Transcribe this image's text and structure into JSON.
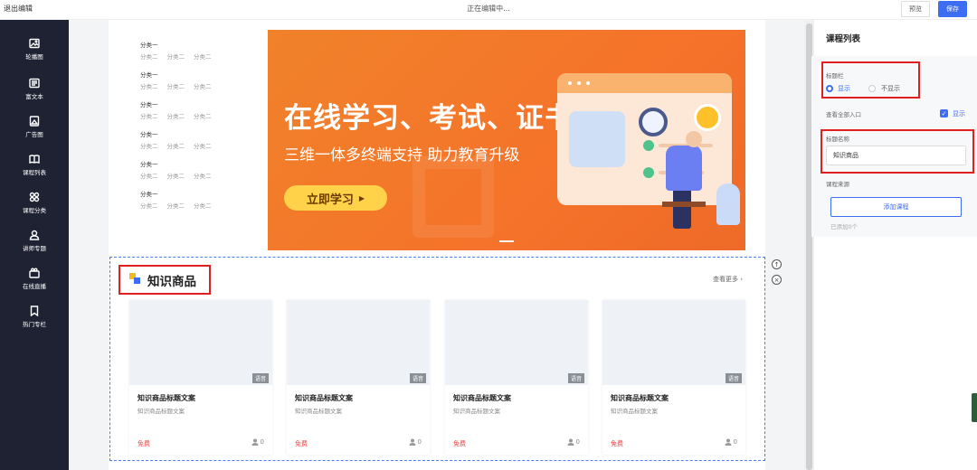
{
  "topbar": {
    "exit_label": "退出编辑",
    "status": "正在编辑中...",
    "preview_label": "预览",
    "save_label": "保存"
  },
  "sidebar": {
    "items": [
      {
        "label": "轮播图",
        "icon": "image-icon"
      },
      {
        "label": "富文本",
        "icon": "rich-text-icon"
      },
      {
        "label": "广告图",
        "icon": "ad-image-icon"
      },
      {
        "label": "课程列表",
        "icon": "book-icon"
      },
      {
        "label": "课程分类",
        "icon": "grid-icon"
      },
      {
        "label": "讲师专题",
        "icon": "user-icon"
      },
      {
        "label": "在线直播",
        "icon": "live-icon"
      },
      {
        "label": "热门专栏",
        "icon": "bookmark-icon"
      }
    ]
  },
  "categories": [
    {
      "title": "分类一",
      "subs": [
        "分类二",
        "分类二",
        "分类二"
      ]
    },
    {
      "title": "分类一",
      "subs": [
        "分类二",
        "分类二",
        "分类二"
      ]
    },
    {
      "title": "分类一",
      "subs": [
        "分类二",
        "分类二",
        "分类二"
      ]
    },
    {
      "title": "分类一",
      "subs": [
        "分类二",
        "分类二",
        "分类二"
      ]
    },
    {
      "title": "分类一",
      "subs": [
        "分类二",
        "分类二",
        "分类二"
      ]
    },
    {
      "title": "分类一",
      "subs": [
        "分类二",
        "分类二",
        "分类二"
      ]
    }
  ],
  "banner": {
    "headline": "在线学习、考试、证书",
    "subline": "三维一体多终端支持 助力教育升级",
    "cta": "立即学习"
  },
  "section": {
    "title": "知识商品",
    "see_more": "查看更多",
    "cards": [
      {
        "tag": "语音",
        "title": "知识商品标题文案",
        "subtitle": "知识商品标题文案",
        "price": "免费",
        "count": "0"
      },
      {
        "tag": "语音",
        "title": "知识商品标题文案",
        "subtitle": "知识商品标题文案",
        "price": "免费",
        "count": "0"
      },
      {
        "tag": "语音",
        "title": "知识商品标题文案",
        "subtitle": "知识商品标题文案",
        "price": "免费",
        "count": "0"
      },
      {
        "tag": "语音",
        "title": "知识商品标题文案",
        "subtitle": "知识商品标题文案",
        "price": "免费",
        "count": "0"
      }
    ]
  },
  "panel": {
    "title": "课程列表",
    "title_bar_label": "标题栏",
    "show_option": "显示",
    "hide_option": "不显示",
    "view_all_label": "查看全部入口",
    "view_all_check": "显示",
    "title_name_label": "标题名称",
    "title_name_value": "知识商品",
    "course_source_label": "课程来源",
    "add_course": "添加课程",
    "added_count": "已添加0个"
  },
  "colors": {
    "accent": "#3d6df2",
    "highlight": "#e02020",
    "sidebar_bg": "#1f2233",
    "banner": "#f5732a"
  }
}
